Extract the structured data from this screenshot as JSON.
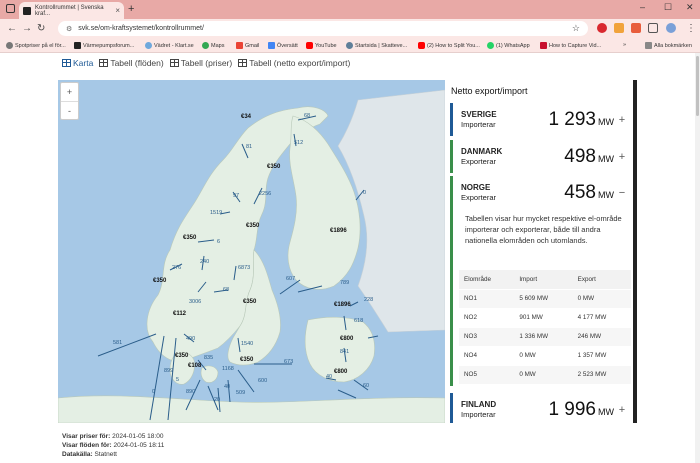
{
  "browser": {
    "tab_title": "Kontrollrummet | Svenska kraf...",
    "url": "svk.se/om-kraftsystemet/kontrollrummet/",
    "bookmarks": [
      "Spotpriser på el för...",
      "Värmepumpsforum...",
      "Vädret - Klart.se",
      "Maps",
      "Gmail",
      "Översätt",
      "YouTube",
      "Startsida | Skatteve...",
      "(2) How to Split You...",
      "(1) WhatsApp",
      "How to Capture Vid..."
    ],
    "all_bookmarks": "Alla bokmärken"
  },
  "views": {
    "map": "Karta",
    "flows": "Tabell (flöden)",
    "prices": "Tabell (priser)",
    "net": "Tabell (netto export/import)"
  },
  "map": {
    "zoom_in": "+",
    "zoom_out": "-",
    "prices": [
      "€34",
      "€350",
      "€350",
      "€350",
      "€350",
      "€350",
      "€350",
      "€1896",
      "€112",
      "€108",
      "€350",
      "€1896",
      "€800",
      "€800"
    ],
    "flows": [
      "68",
      "81",
      "512",
      "97",
      "2256",
      "1519",
      "6",
      "0",
      "240",
      "276",
      "6873",
      "3006",
      "68",
      "607",
      "789",
      "228",
      "618",
      "841",
      "490",
      "1540",
      "899",
      "1168",
      "673",
      "835",
      "40",
      "890",
      "600",
      "509",
      "60",
      "5",
      "0",
      "581",
      "20",
      "40"
    ]
  },
  "panel": {
    "title": "Netto export/import",
    "countries": [
      {
        "name": "SVERIGE",
        "status": "Importerar",
        "value": "1 293",
        "unit": "MW",
        "toggle": "+"
      },
      {
        "name": "DANMARK",
        "status": "Exporterar",
        "value": "498",
        "unit": "MW",
        "toggle": "+"
      },
      {
        "name": "NORGE",
        "status": "Exporterar",
        "value": "458",
        "unit": "MW",
        "toggle": "−"
      },
      {
        "name": "FINLAND",
        "status": "Importerar",
        "value": "1 996",
        "unit": "MW",
        "toggle": "+"
      }
    ],
    "description": "Tabellen visar hur mycket respektive el-område importerar och exporterar, både till andra nationella elområden och utomlands.",
    "table": {
      "headers": [
        "Elområde",
        "Import",
        "Export"
      ],
      "rows": [
        [
          "NO1",
          "5 609 MW",
          "0 MW"
        ],
        [
          "NO2",
          "901 MW",
          "4 177 MW"
        ],
        [
          "NO3",
          "1 336 MW",
          "246 MW"
        ],
        [
          "NO4",
          "0 MW",
          "1 357 MW"
        ],
        [
          "NO5",
          "0 MW",
          "2 523 MW"
        ]
      ]
    }
  },
  "footer": {
    "prices_label": "Visar priser för:",
    "prices_value": "2024-01-05 18:00",
    "flows_label": "Visar flöden för:",
    "flows_value": "2024-01-05 18:11",
    "source_label": "Datakälla:",
    "source_value": "Statnett"
  },
  "colors": {
    "sweden_bar": "#1f5a96",
    "denmark_bar": "#3a8f4a",
    "norway_bar": "#3a8f4a",
    "finland_bar": "#1f5a96",
    "land": "#e4efe4",
    "sea": "#a6c8e6"
  }
}
